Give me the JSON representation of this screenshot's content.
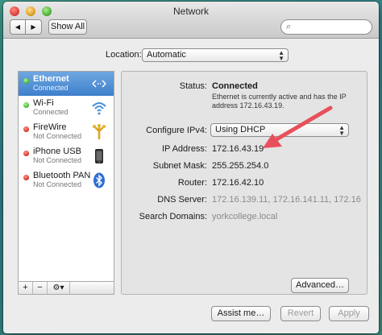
{
  "window": {
    "title": "Network"
  },
  "toolbar": {
    "back_label": "◀",
    "forward_label": "▶",
    "show_all_label": "Show All",
    "search_placeholder": ""
  },
  "location": {
    "label": "Location:",
    "value": "Automatic"
  },
  "services": [
    {
      "name": "Ethernet",
      "status": "Connected",
      "dot": "green",
      "icon": "ethernet-icon",
      "selected": true
    },
    {
      "name": "Wi-Fi",
      "status": "Connected",
      "dot": "green",
      "icon": "wifi-icon",
      "selected": false
    },
    {
      "name": "FireWire",
      "status": "Not Connected",
      "dot": "red",
      "icon": "firewire-icon",
      "selected": false
    },
    {
      "name": "iPhone USB",
      "status": "Not Connected",
      "dot": "red",
      "icon": "iphone-icon",
      "selected": false
    },
    {
      "name": "Bluetooth PAN",
      "status": "Not Connected",
      "dot": "red",
      "icon": "bluetooth-icon",
      "selected": false
    }
  ],
  "sidebar_tools": {
    "add": "+",
    "remove": "−",
    "gear": "⚙▾"
  },
  "detail": {
    "status_label": "Status:",
    "status_value": "Connected",
    "status_description": "Ethernet is currently active and has the IP address 172.16.43.19.",
    "configure_label": "Configure IPv4:",
    "configure_value": "Using DHCP",
    "ip_label": "IP Address:",
    "ip_value": "172.16.43.19",
    "subnet_label": "Subnet Mask:",
    "subnet_value": "255.255.254.0",
    "router_label": "Router:",
    "router_value": "172.16.42.10",
    "dns_label": "DNS Server:",
    "dns_value": "172.16.139.11, 172.16.141.11, 172.16.",
    "search_domains_label": "Search Domains:",
    "search_domains_value": "yorkcollege.local",
    "advanced_label": "Advanced…"
  },
  "bottom": {
    "assist_label": "Assist me…",
    "revert_label": "Revert",
    "apply_label": "Apply"
  },
  "colors": {
    "selection": "#3e7fcc",
    "annotation_arrow": "#e8505b",
    "connected": "#3cb324",
    "not_connected": "#d42a20"
  }
}
